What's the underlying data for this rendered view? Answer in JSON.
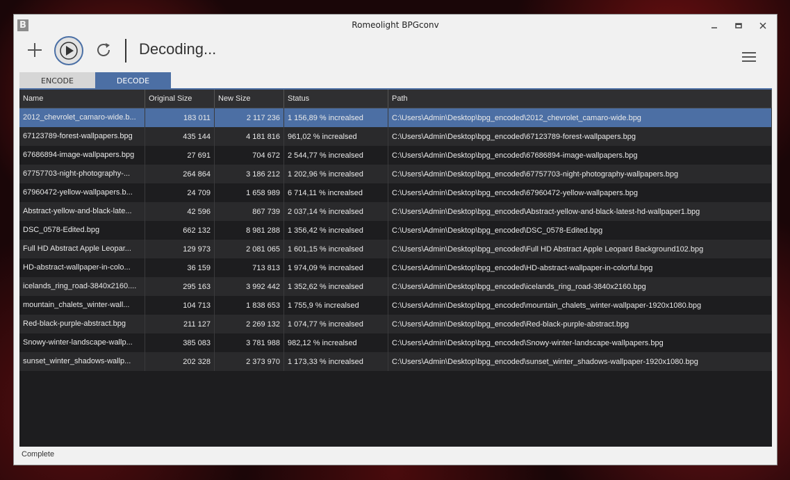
{
  "window": {
    "title": "Romeolight BPGconv",
    "app_icon": "B"
  },
  "toolbar": {
    "status": "Decoding..."
  },
  "tabs": [
    {
      "label": "ENCODE"
    },
    {
      "label": "DECODE"
    }
  ],
  "columns": {
    "name": "Name",
    "original_size": "Original Size",
    "new_size": "New Size",
    "status": "Status",
    "path": "Path"
  },
  "rows": [
    {
      "name": "2012_chevrolet_camaro-wide.b...",
      "original": "183 011",
      "new": "2 117 236",
      "status": "1 156,89 % increalsed",
      "path": "C:\\Users\\Admin\\Desktop\\bpg_encoded\\2012_chevrolet_camaro-wide.bpg"
    },
    {
      "name": "67123789-forest-wallpapers.bpg",
      "original": "435 144",
      "new": "4 181 816",
      "status": "961,02 % increalsed",
      "path": "C:\\Users\\Admin\\Desktop\\bpg_encoded\\67123789-forest-wallpapers.bpg"
    },
    {
      "name": "67686894-image-wallpapers.bpg",
      "original": "27 691",
      "new": "704 672",
      "status": "2 544,77 % increalsed",
      "path": "C:\\Users\\Admin\\Desktop\\bpg_encoded\\67686894-image-wallpapers.bpg"
    },
    {
      "name": "67757703-night-photography-...",
      "original": "264 864",
      "new": "3 186 212",
      "status": "1 202,96 % increalsed",
      "path": "C:\\Users\\Admin\\Desktop\\bpg_encoded\\67757703-night-photography-wallpapers.bpg"
    },
    {
      "name": "67960472-yellow-wallpapers.b...",
      "original": "24 709",
      "new": "1 658 989",
      "status": "6 714,11 % increalsed",
      "path": "C:\\Users\\Admin\\Desktop\\bpg_encoded\\67960472-yellow-wallpapers.bpg"
    },
    {
      "name": "Abstract-yellow-and-black-late...",
      "original": "42 596",
      "new": "867 739",
      "status": "2 037,14 % increalsed",
      "path": "C:\\Users\\Admin\\Desktop\\bpg_encoded\\Abstract-yellow-and-black-latest-hd-wallpaper1.bpg"
    },
    {
      "name": "DSC_0578-Edited.bpg",
      "original": "662 132",
      "new": "8 981 288",
      "status": "1 356,42 % increalsed",
      "path": "C:\\Users\\Admin\\Desktop\\bpg_encoded\\DSC_0578-Edited.bpg"
    },
    {
      "name": "Full HD Abstract Apple Leopar...",
      "original": "129 973",
      "new": "2 081 065",
      "status": "1 601,15 % increalsed",
      "path": "C:\\Users\\Admin\\Desktop\\bpg_encoded\\Full HD Abstract Apple Leopard Background102.bpg"
    },
    {
      "name": "HD-abstract-wallpaper-in-colo...",
      "original": "36 159",
      "new": "713 813",
      "status": "1 974,09 % increalsed",
      "path": "C:\\Users\\Admin\\Desktop\\bpg_encoded\\HD-abstract-wallpaper-in-colorful.bpg"
    },
    {
      "name": "icelands_ring_road-3840x2160....",
      "original": "295 163",
      "new": "3 992 442",
      "status": "1 352,62 % increalsed",
      "path": "C:\\Users\\Admin\\Desktop\\bpg_encoded\\icelands_ring_road-3840x2160.bpg"
    },
    {
      "name": "mountain_chalets_winter-wall...",
      "original": "104 713",
      "new": "1 838 653",
      "status": "1 755,9 % increalsed",
      "path": "C:\\Users\\Admin\\Desktop\\bpg_encoded\\mountain_chalets_winter-wallpaper-1920x1080.bpg"
    },
    {
      "name": "Red-black-purple-abstract.bpg",
      "original": "211 127",
      "new": "2 269 132",
      "status": "1 074,77 % increalsed",
      "path": "C:\\Users\\Admin\\Desktop\\bpg_encoded\\Red-black-purple-abstract.bpg"
    },
    {
      "name": "Snowy-winter-landscape-wallp...",
      "original": "385 083",
      "new": "3 781 988",
      "status": "982,12 % increalsed",
      "path": "C:\\Users\\Admin\\Desktop\\bpg_encoded\\Snowy-winter-landscape-wallpapers.bpg"
    },
    {
      "name": "sunset_winter_shadows-wallp...",
      "original": "202 328",
      "new": "2 373 970",
      "status": "1 173,33 % increalsed",
      "path": "C:\\Users\\Admin\\Desktop\\bpg_encoded\\sunset_winter_shadows-wallpaper-1920x1080.bpg"
    }
  ],
  "statusbar": {
    "text": "Complete"
  },
  "colors": {
    "accent": "#4c6fa4",
    "grid_bg": "#1d1d1f",
    "row_alt": "#2a2a2c"
  },
  "icons": {
    "add": "plus-icon",
    "play": "play-icon",
    "refresh": "refresh-icon",
    "menu": "hamburger-menu-icon"
  }
}
